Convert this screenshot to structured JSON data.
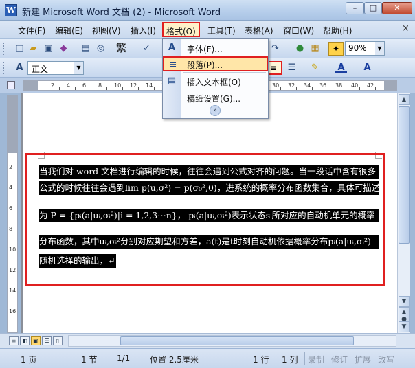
{
  "window": {
    "title": "新建 Microsoft Word 文档 (2) - Microsoft Word",
    "app_icon": "W",
    "min_glyph": "–",
    "max_glyph": "□",
    "close_glyph": "✕"
  },
  "menubar": {
    "items": [
      "文件(F)",
      "编辑(E)",
      "视图(V)",
      "插入(I)",
      "格式(O)",
      "工具(T)",
      "表格(A)",
      "窗口(W)",
      "帮助(H)"
    ],
    "active_index": 4,
    "close_glyph": "×"
  },
  "toolbar": {
    "zoom": "90%",
    "style": "正文",
    "font_size_glyph": "繁",
    "arrow": "▼"
  },
  "format_menu": {
    "items": [
      {
        "label": "字体(F)...",
        "icon": "font-icon",
        "glyph": "A"
      },
      {
        "label": "段落(P)...",
        "icon": "paragraph-icon",
        "glyph": "≡"
      },
      {
        "label": "插入文本框(O)",
        "icon": "textbox-icon",
        "glyph": "▤"
      },
      {
        "label": "稿纸设置(G)...",
        "icon": "",
        "glyph": ""
      }
    ],
    "highlighted_index": 1,
    "expand_glyph": "»"
  },
  "ruler": {
    "h_numbers": [
      "2",
      "4",
      "6",
      "8",
      "10",
      "12",
      "14",
      "16",
      "18",
      "20",
      "22",
      "24",
      "26",
      "28",
      "30",
      "32",
      "34",
      "36",
      "38",
      "40",
      "42"
    ],
    "v_numbers": [
      "2",
      "4",
      "6",
      "8",
      "10",
      "12",
      "14",
      "16"
    ]
  },
  "document": {
    "lines": [
      "当我们对 word 文档进行编辑的时候，往往会遇到公式对齐的问题。当一段话中含有很多",
      "公式的时候往往会遇到lim p(u,σ²) = p(σ₀²,0)，进系统的概率分布函数集合，具体可描述",
      "为 P = {pᵢ(a|uᵢ,σᵢ²)|i = 1,2,3⋯n}，  pᵢ(a|uᵢ,σᵢ²)表示状态sᵢ所对应的自动机单元的概率",
      "分布函数，其中uᵢ,σᵢ²分别对应期望和方差，a(t)是t时刻自动机依据概率分布pᵢ(a|uᵢ,σᵢ²)",
      "随机选择的输出，↵"
    ]
  },
  "statusbar": {
    "page": "1 页",
    "section": "1 节",
    "page_of": "1/1",
    "position": "位置 2.5厘米",
    "line": "1 行",
    "column": "1 列",
    "rec": "录制",
    "trk": "修订",
    "ext": "扩展",
    "ovr": "改写"
  },
  "colors": {
    "highlight_box": "#e02020",
    "selection_bg": "#000000",
    "menu_highlight": "#ffe6a8"
  }
}
